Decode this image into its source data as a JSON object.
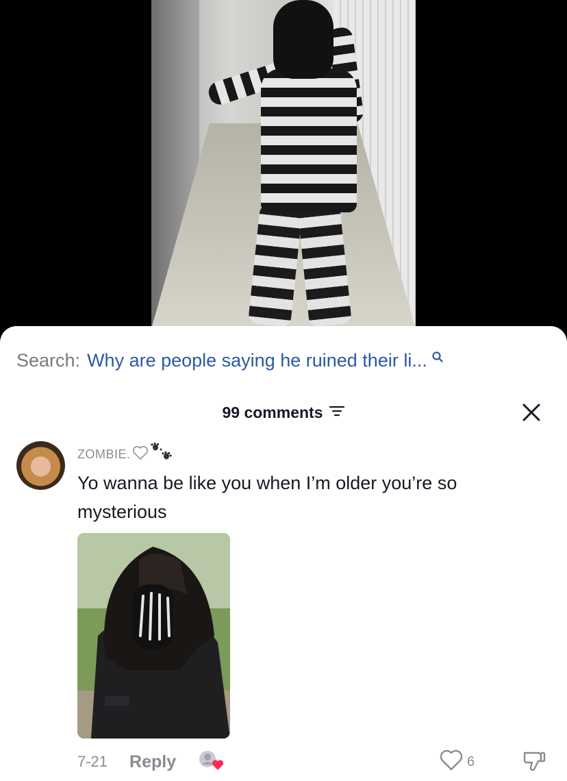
{
  "search": {
    "label": "Search:",
    "query": "Why are people saying he ruined their li..."
  },
  "comments_header": {
    "count_label": "99 comments"
  },
  "comment": {
    "username": "ZOMBIE.",
    "text": "Yo wanna be like you when I’m older you’re so mysterious",
    "date": "7-21",
    "reply_label": "Reply",
    "like_count": "6"
  },
  "colors": {
    "search_query": "#2b5aa0",
    "muted_text": "#8a8b91",
    "like_heart_accent": "#fe2c55"
  },
  "icons": {
    "search": "search-icon",
    "filter": "filter-icon",
    "close": "close-icon",
    "like": "heart-outline-icon",
    "dislike": "thumbs-down-icon",
    "username_decor": [
      "heart-outline-icon",
      "paw-prints-icon"
    ]
  }
}
